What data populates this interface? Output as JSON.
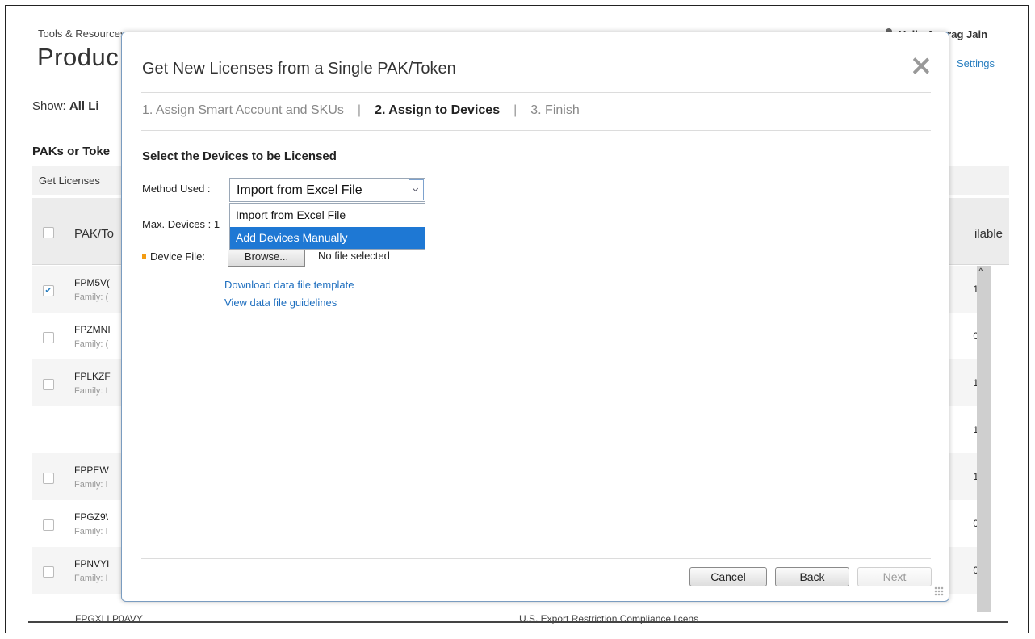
{
  "background": {
    "breadcrumb": "Tools & Resources",
    "page_title": "Produc",
    "greeting": "Hello Anurag Jain",
    "settings_link": "Settings",
    "show_label": "Show:",
    "show_value": "All Li",
    "section_title": "PAKs or Toke",
    "toolbar_label": "Get Licenses",
    "col_pak": "PAK/To",
    "col_available": "ilable",
    "rows": [
      {
        "code": "FPM5V(",
        "family": "Family: (",
        "available": "1",
        "checked": true
      },
      {
        "code": "FPZMNI",
        "family": "Family: (",
        "available": "0",
        "checked": false
      },
      {
        "code": "FPLKZF",
        "family": "Family: I",
        "available": "1",
        "checked": false
      },
      {
        "code": "",
        "family": "",
        "available": "1",
        "checked": false
      },
      {
        "code": "FPPEW",
        "family": "Family: I",
        "available": "1",
        "checked": false
      },
      {
        "code": "FPGZ9\\",
        "family": "Family: I",
        "available": "0",
        "checked": false
      },
      {
        "code": "FPNVYI",
        "family": "Family: I",
        "available": "0",
        "checked": false
      }
    ],
    "cut_row_code": "FPGXLLP0AVY",
    "cut_row_text": "U.S. Export Restriction Compliance licens"
  },
  "modal": {
    "title": "Get New Licenses from a Single PAK/Token",
    "steps": [
      {
        "label": "1. Assign Smart Account and SKUs",
        "active": false
      },
      {
        "label": "2. Assign to Devices",
        "active": true
      },
      {
        "label": "3. Finish",
        "active": false
      }
    ],
    "section_title": "Select the Devices to be Licensed",
    "method_label": "Method Used :",
    "method_value": "Import from Excel File",
    "method_options": [
      "Import from Excel File",
      "Add Devices Manually"
    ],
    "highlighted_option": "Add Devices Manually",
    "max_devices_label": "Max. Devices : 1",
    "device_file_label": "Device File:",
    "browse_label": "Browse...",
    "no_file_text": "No file selected",
    "link_template": "Download data file template",
    "link_guidelines": "View data file guidelines",
    "buttons": {
      "cancel": "Cancel",
      "back": "Back",
      "next": "Next"
    }
  },
  "colors": {
    "accent": "#1e78d4",
    "link": "#1f6fbf",
    "required_marker": "#f39c12"
  }
}
